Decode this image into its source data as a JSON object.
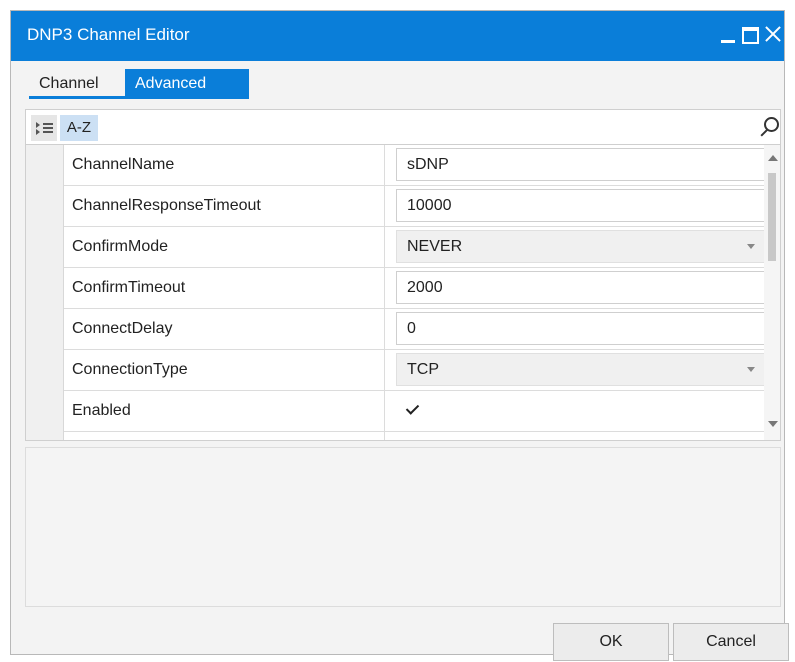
{
  "window": {
    "title": "DNP3 Channel Editor"
  },
  "tabs": [
    {
      "label": "Channel",
      "selected": false
    },
    {
      "label": "Advanced",
      "selected": true
    }
  ],
  "toolbar": {
    "sort_label": "A-Z",
    "search_value": ""
  },
  "properties": [
    {
      "name": "ChannelName",
      "value": "sDNP",
      "kind": "text"
    },
    {
      "name": "ChannelResponseTimeout",
      "value": "10000",
      "kind": "text"
    },
    {
      "name": "ConfirmMode",
      "value": "NEVER",
      "kind": "dropdown"
    },
    {
      "name": "ConfirmTimeout",
      "value": "2000",
      "kind": "text"
    },
    {
      "name": "ConnectDelay",
      "value": "0",
      "kind": "text"
    },
    {
      "name": "ConnectionType",
      "value": "TCP",
      "kind": "dropdown"
    },
    {
      "name": "Enabled",
      "value": true,
      "kind": "checkbox"
    }
  ],
  "buttons": {
    "ok": "OK",
    "cancel": "Cancel"
  },
  "colors": {
    "accent": "#0a7ed9"
  }
}
